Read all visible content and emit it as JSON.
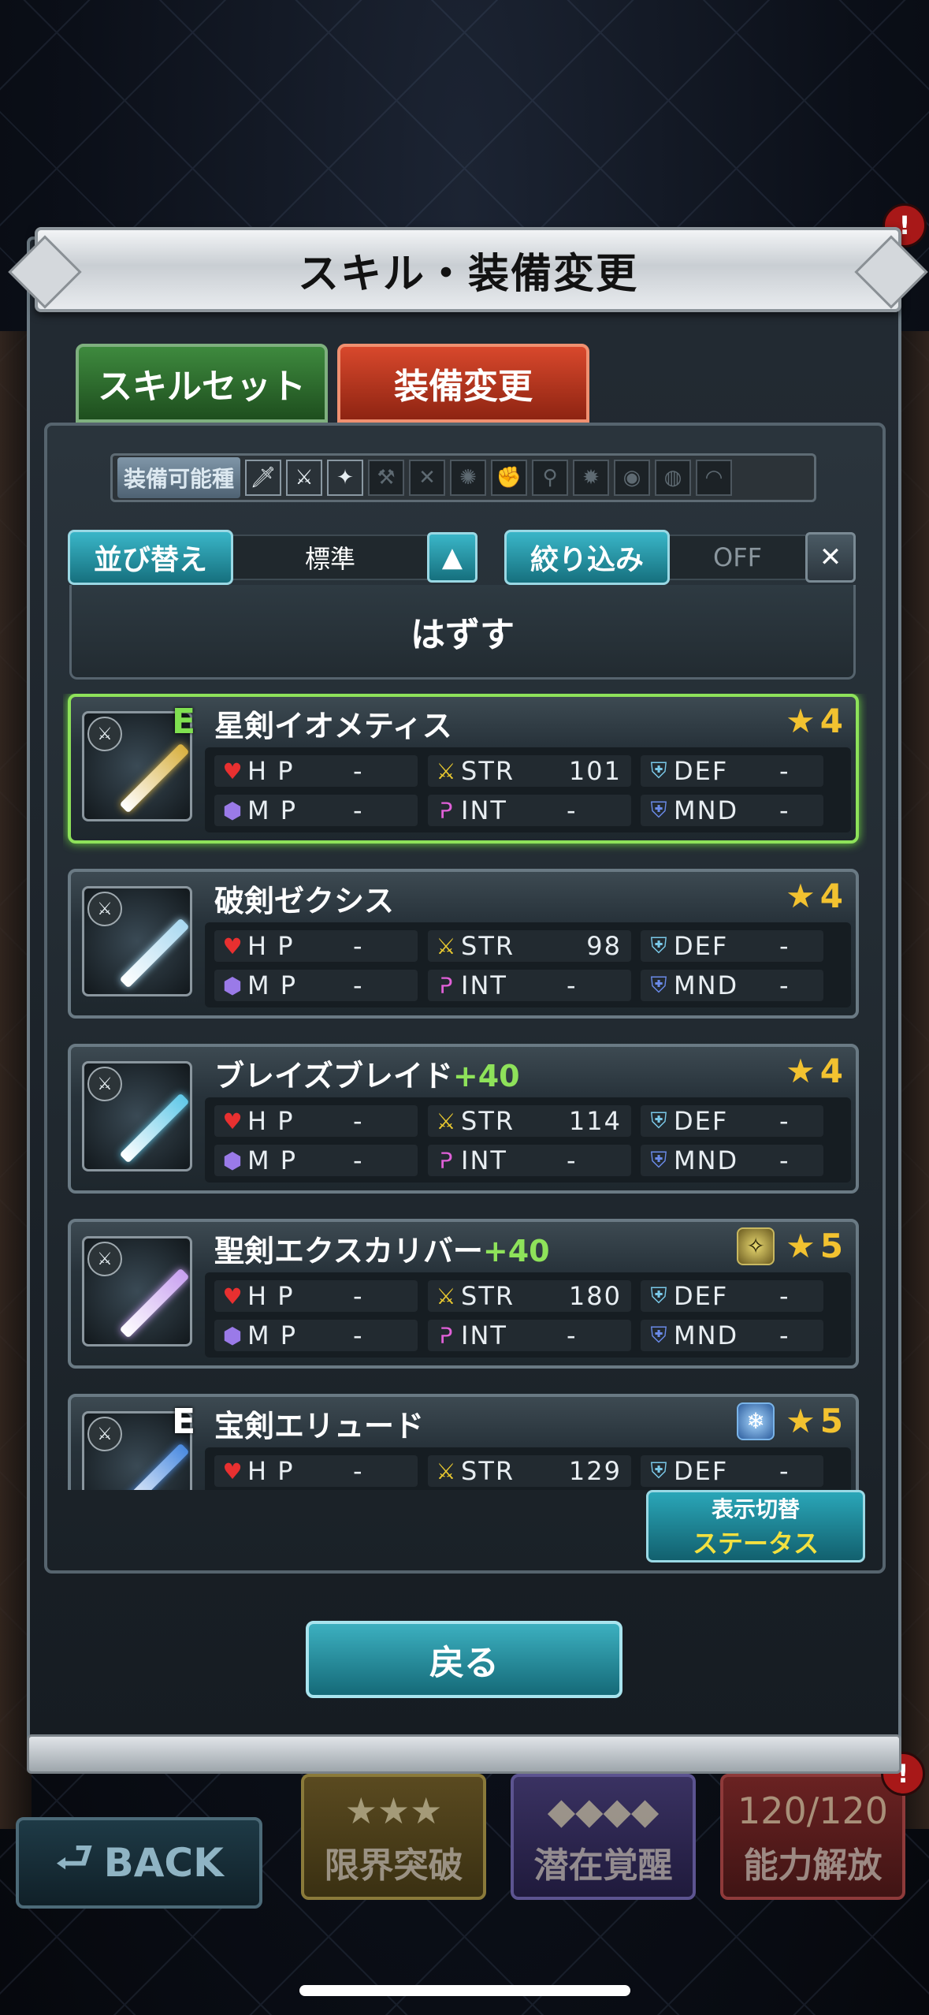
{
  "modal": {
    "title": "スキル・装備変更",
    "tabs": {
      "skill": "スキルセット",
      "equip": "装備変更"
    },
    "equip_types": {
      "label": "装備可能種",
      "icons": [
        {
          "name": "dagger-icon",
          "glyph": "🗡",
          "enabled": true
        },
        {
          "name": "sword-icon",
          "glyph": "⚔",
          "enabled": true
        },
        {
          "name": "knight-sword-icon",
          "glyph": "✦",
          "enabled": true
        },
        {
          "name": "axe-icon",
          "glyph": "⚒",
          "enabled": false
        },
        {
          "name": "katana-icon",
          "glyph": "✕",
          "enabled": false
        },
        {
          "name": "gear-weapon-icon",
          "glyph": "✺",
          "enabled": false
        },
        {
          "name": "fist-icon",
          "glyph": "✊",
          "enabled": false
        },
        {
          "name": "rod-icon",
          "glyph": "⚲",
          "enabled": false
        },
        {
          "name": "spiked-icon",
          "glyph": "✹",
          "enabled": false
        },
        {
          "name": "armor-icon",
          "glyph": "◉",
          "enabled": false
        },
        {
          "name": "heavy-armor-icon",
          "glyph": "◍",
          "enabled": false
        },
        {
          "name": "helmet-icon",
          "glyph": "◠",
          "enabled": false
        }
      ]
    },
    "sort": {
      "label": "並び替え",
      "value": "標準",
      "order_icon": "▲"
    },
    "filter": {
      "label": "絞り込み",
      "value": "OFF",
      "clear_icon": "✕"
    },
    "unequip": "はずす",
    "stat_labels": {
      "hp": "H P",
      "mp": "M P",
      "str": "STR",
      "int": "INT",
      "def": "DEF",
      "mnd": "MND"
    },
    "items": [
      {
        "name": "星剣イオメティス",
        "plus": "",
        "rarity": "4",
        "equipped": "E",
        "selected": true,
        "element": "",
        "hp": "-",
        "mp": "-",
        "str": "101",
        "int": "-",
        "def": "-",
        "mnd": "-",
        "blade": "#d8b040"
      },
      {
        "name": "破剣ゼクシス",
        "plus": "",
        "rarity": "4",
        "equipped": "",
        "selected": false,
        "element": "",
        "hp": "-",
        "mp": "-",
        "str": "98",
        "int": "-",
        "def": "-",
        "mnd": "-",
        "blade": "#a8d8f0"
      },
      {
        "name": "ブレイズブレイド",
        "plus": "+40",
        "rarity": "4",
        "equipped": "",
        "selected": false,
        "element": "",
        "hp": "-",
        "mp": "-",
        "str": "114",
        "int": "-",
        "def": "-",
        "mnd": "-",
        "blade": "#60c8e8"
      },
      {
        "name": "聖剣エクスカリバー",
        "plus": "+40",
        "rarity": "5",
        "equipped": "",
        "selected": false,
        "element": "holy",
        "hp": "-",
        "mp": "-",
        "str": "180",
        "int": "-",
        "def": "-",
        "mnd": "-",
        "blade": "#c8a0f0"
      },
      {
        "name": "宝剣エリュード",
        "plus": "",
        "rarity": "5",
        "equipped": "E",
        "selected": false,
        "element": "ice",
        "hp": "-",
        "mp": "-",
        "str": "129",
        "int": "-",
        "def": "-",
        "mnd": "-",
        "blade": "#4a8ae0"
      }
    ],
    "display_toggle": {
      "label": "表示切替",
      "value": "ステータス"
    },
    "back": "戻る"
  },
  "background": {
    "back_button": "BACK",
    "tiles": [
      {
        "label": "限界突破",
        "icon": "★★★"
      },
      {
        "label": "潜在覚醒",
        "icon": "◆◆◆◆"
      },
      {
        "label": "能力解放",
        "icon": "120/120"
      }
    ],
    "alert": "!"
  }
}
